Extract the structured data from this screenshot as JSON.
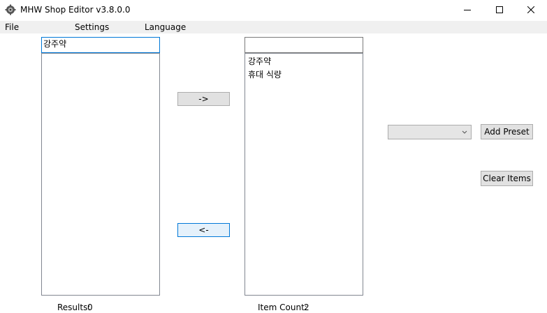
{
  "window": {
    "title": "MHW Shop Editor v3.8.0.0",
    "icons": {
      "app": "app-gear-icon",
      "minimize": "minimize-icon",
      "maximize": "maximize-icon",
      "close": "close-icon"
    }
  },
  "menu": {
    "file": "File",
    "settings": "Settings",
    "language": "Language"
  },
  "left_panel": {
    "search_value": "강주약",
    "items": [],
    "results_label": "Results:",
    "results_count": "0"
  },
  "right_panel": {
    "filter_value": "",
    "items": [
      "강주약",
      "휴대 식량"
    ],
    "count_label": "Item Count:",
    "count_value": "2"
  },
  "buttons": {
    "add_arrow": "->",
    "remove_arrow": "<-",
    "add_preset": "Add Preset",
    "clear_items": "Clear Items"
  },
  "preset_dropdown": {
    "selected": "",
    "icon": "chevron-down-icon"
  },
  "colors": {
    "accent": "#0078d7",
    "button_face": "#e1e1e1",
    "button_hover": "#e5f1fb",
    "menu_bg": "#f0f0f0"
  }
}
